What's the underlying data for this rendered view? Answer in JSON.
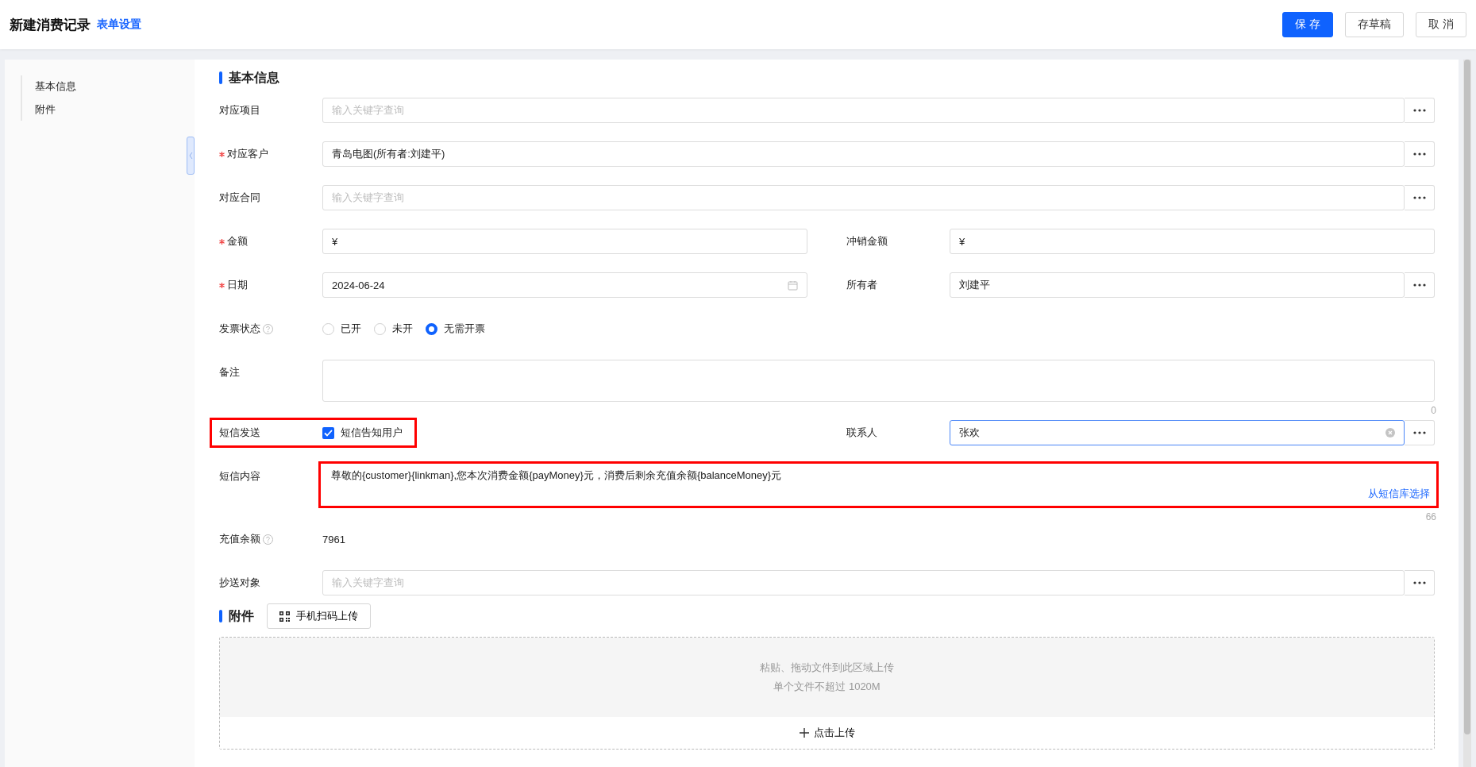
{
  "header": {
    "title": "新建消费记录",
    "settings_link": "表单设置",
    "buttons": [
      {
        "label": "保 存",
        "kind": "primary"
      },
      {
        "label": "存草稿",
        "kind": "default"
      },
      {
        "label": "取 消",
        "kind": "default"
      }
    ]
  },
  "sidebar": {
    "items": [
      {
        "label": "基本信息"
      },
      {
        "label": "附件"
      }
    ]
  },
  "section_title": "基本信息",
  "rows": [
    [
      {
        "label": "对应项目",
        "required": false,
        "kind": "lookup",
        "placeholder": "输入关键字查询"
      }
    ],
    [
      {
        "label": "对应客户",
        "required": true,
        "kind": "lookup",
        "value": "青岛电图(所有者:刘建平)"
      }
    ],
    [
      {
        "label": "对应合同",
        "required": false,
        "kind": "lookup",
        "placeholder": "输入关键字查询"
      }
    ],
    [
      {
        "label": "金额",
        "required": true,
        "kind": "text",
        "value": "¥"
      },
      {
        "label": "冲销金额",
        "required": false,
        "kind": "text",
        "value": "¥"
      }
    ],
    [
      {
        "label": "日期",
        "required": true,
        "kind": "date",
        "value": "2024-06-24"
      },
      {
        "label": "所有者",
        "required": false,
        "kind": "lookup",
        "value": "刘建平"
      }
    ],
    [
      {
        "label": "发票状态",
        "required": false,
        "help": true,
        "kind": "radio",
        "options": [
          {
            "label": "已开",
            "selected": false
          },
          {
            "label": "未开",
            "selected": false
          },
          {
            "label": "无需开票",
            "selected": true
          }
        ]
      }
    ],
    [
      {
        "label": "备注",
        "required": false,
        "kind": "textarea",
        "counter": "0"
      }
    ],
    [
      {
        "label": "短信发送",
        "required": false,
        "kind": "checkbox",
        "option": "短信告知用户",
        "checked": true,
        "highlighted": true
      },
      {
        "label": "联系人",
        "required": false,
        "kind": "lookup",
        "value": "张欢",
        "focused": true,
        "clearable": true
      }
    ],
    [
      {
        "label": "短信内容",
        "required": false,
        "kind": "sms",
        "value": "尊敬的{customer}{linkman},您本次消费金额{payMoney}元，消费后剩余充值余额{balanceMoney}元",
        "link": "从短信库选择",
        "counter": "66",
        "highlighted": true
      }
    ],
    [
      {
        "label": "充值余额",
        "required": false,
        "help": true,
        "kind": "static",
        "value": "7961"
      }
    ],
    [
      {
        "label": "抄送对象",
        "required": false,
        "kind": "lookup",
        "placeholder": "输入关键字查询"
      }
    ]
  ],
  "attachments": {
    "title": "附件",
    "scan_button": "手机扫码上传",
    "drop_lines": [
      "粘贴、拖动文件到此区域上传",
      "单个文件不超过 1020M"
    ],
    "upload_button": "点击上传"
  }
}
